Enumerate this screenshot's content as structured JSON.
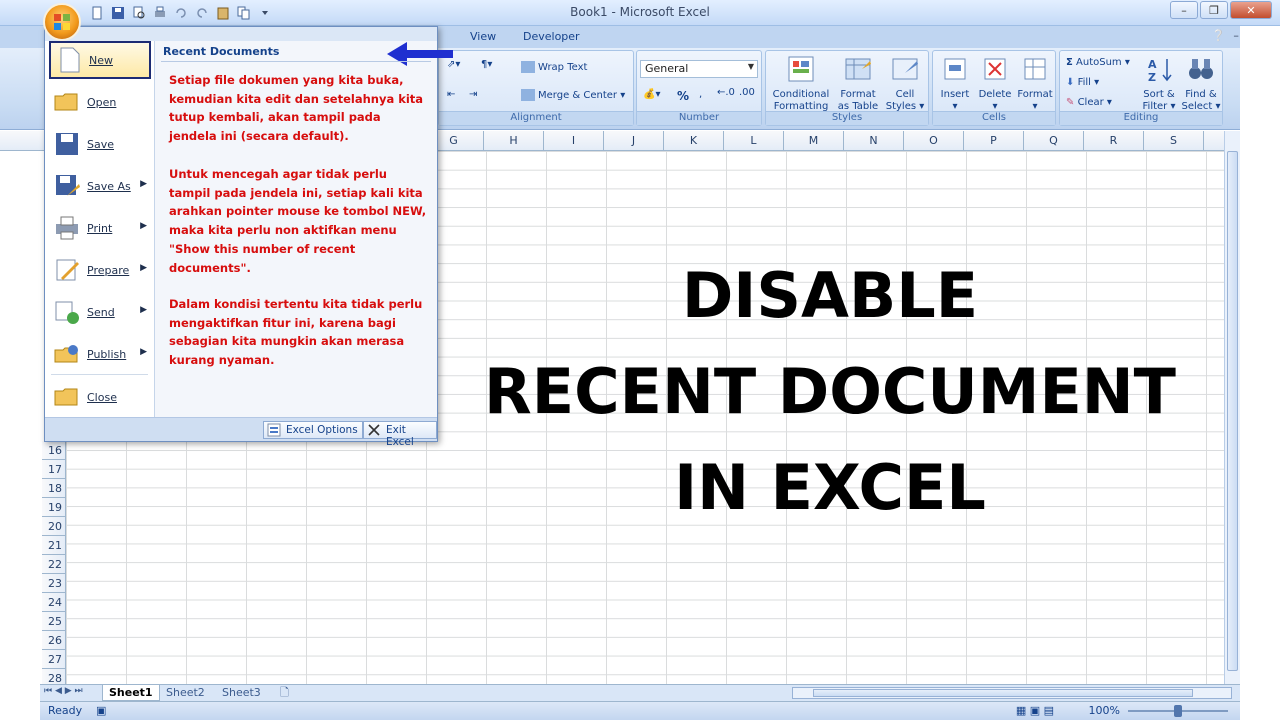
{
  "window": {
    "title": "Book1 - Microsoft Excel"
  },
  "tabs": [
    "View",
    "Developer"
  ],
  "ribbon": {
    "alignment": {
      "wrap_text": "Wrap Text",
      "merge_center": "Merge & Center",
      "label": "Alignment"
    },
    "number": {
      "format": "General",
      "percent": "%",
      "label": "Number"
    },
    "styles": {
      "conditional_formatting_1": "Conditional",
      "conditional_formatting_2": "Formatting",
      "format_table_1": "Format",
      "format_table_2": "as Table",
      "cell_styles_1": "Cell",
      "cell_styles_2": "Styles",
      "label": "Styles"
    },
    "cells": {
      "insert": "Insert",
      "delete": "Delete",
      "format": "Format",
      "label": "Cells"
    },
    "editing": {
      "autosum": "AutoSum",
      "fill": "Fill",
      "clear": "Clear",
      "sort_filter_1": "Sort &",
      "sort_filter_2": "Filter",
      "find_select_1": "Find &",
      "find_select_2": "Select",
      "label": "Editing"
    }
  },
  "columns": [
    "G",
    "H",
    "I",
    "J",
    "K",
    "L",
    "M",
    "N",
    "O",
    "P",
    "Q",
    "R",
    "S"
  ],
  "rows": [
    "16",
    "17",
    "18",
    "19",
    "20",
    "21",
    "22",
    "23",
    "24",
    "25",
    "26",
    "27",
    "28"
  ],
  "office_menu": {
    "items": [
      {
        "label": "New",
        "has_arrow": false
      },
      {
        "label": "Open",
        "has_arrow": false
      },
      {
        "label": "Save",
        "has_arrow": false
      },
      {
        "label": "Save As",
        "has_arrow": true
      },
      {
        "label": "Print",
        "has_arrow": true
      },
      {
        "label": "Prepare",
        "has_arrow": true
      },
      {
        "label": "Send",
        "has_arrow": true
      },
      {
        "label": "Publish",
        "has_arrow": true
      },
      {
        "label": "Close",
        "has_arrow": false
      }
    ],
    "recent_header": "Recent Documents",
    "notes": [
      "Setiap file dokumen yang kita buka, kemudian kita edit dan setelahnya kita tutup kembali, akan tampil pada jendela ini (secara default).",
      "Untuk mencegah agar tidak perlu tampil pada jendela ini, setiap kali kita arahkan pointer mouse ke tombol NEW, maka kita perlu non aktifkan menu \"Show this number of recent documents\".",
      "Dalam kondisi tertentu kita tidak perlu mengaktifkan fitur ini, karena bagi sebagian kita mungkin akan merasa kurang nyaman."
    ],
    "excel_options": "Excel Options",
    "exit_excel": "Exit Excel"
  },
  "headline": [
    "DISABLE",
    "RECENT DOCUMENT",
    "IN EXCEL"
  ],
  "sheets": [
    "Sheet1",
    "Sheet2",
    "Sheet3"
  ],
  "status": {
    "ready": "Ready",
    "zoom": "100%",
    "zoom_level_pct": 100
  },
  "colors": {
    "menu_note_red": "#d70e0e",
    "accent_blue": "#15428b",
    "arrow_blue": "#1f2fd0"
  }
}
